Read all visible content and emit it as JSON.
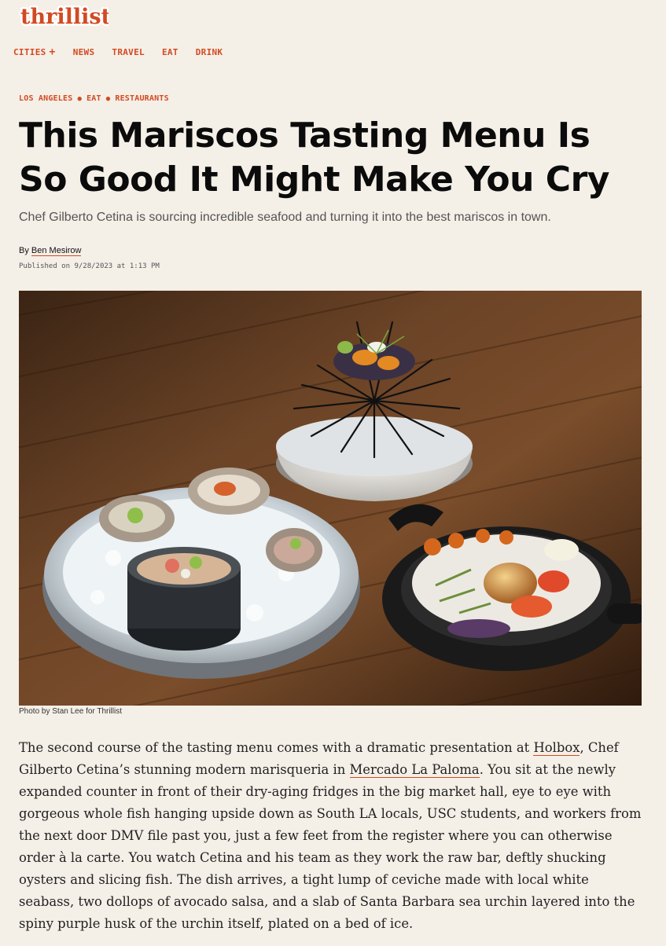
{
  "site": {
    "logo_text": "thrillist",
    "brand_color": "#d24a22",
    "background_color": "#f4efe7"
  },
  "nav": {
    "items": [
      {
        "label": "CITIES",
        "icon": "plus-icon"
      },
      {
        "label": "NEWS"
      },
      {
        "label": "TRAVEL"
      },
      {
        "label": "EAT"
      },
      {
        "label": "DRINK"
      }
    ]
  },
  "breadcrumb": [
    "LOS ANGELES",
    "EAT",
    "RESTAURANTS"
  ],
  "article": {
    "headline": "This Mariscos Tasting Menu Is So Good It Might Make You Cry",
    "dek": "Chef Gilberto Cetina is sourcing incredible seafood and turning it into the best mariscos in town.",
    "byline_prefix": "By",
    "author": "Ben Mesirow",
    "published": "Published on 9/28/2023 at 1:13 PM",
    "hero_caption": "Photo by Stan Lee for Thrillist",
    "body": {
      "p1_a": "The second course of the tasting menu comes with a dramatic presentation at ",
      "link1": "Holbox",
      "p1_b": ", Chef Gilberto Cetina’s stunning modern marisqueria in ",
      "link2": "Mercado La Paloma",
      "p1_c": ". You sit at the newly expanded counter in front of their dry-aging fridges in the big market hall, eye to eye with gorgeous whole fish hanging upside down as South LA locals, USC students, and workers from the next door DMV file past you, just a few feet from the register where you can otherwise order à la carte. You watch Cetina and his team as they work the raw bar, deftly shucking oysters and slicing fish. The dish arrives, a tight lump of ceviche made with local white seabass, two dollops of avocado salsa, and a slab of Santa Barbara sea urchin layered into the spiny purple husk of the urchin itself, plated on a bed of ice."
    }
  }
}
